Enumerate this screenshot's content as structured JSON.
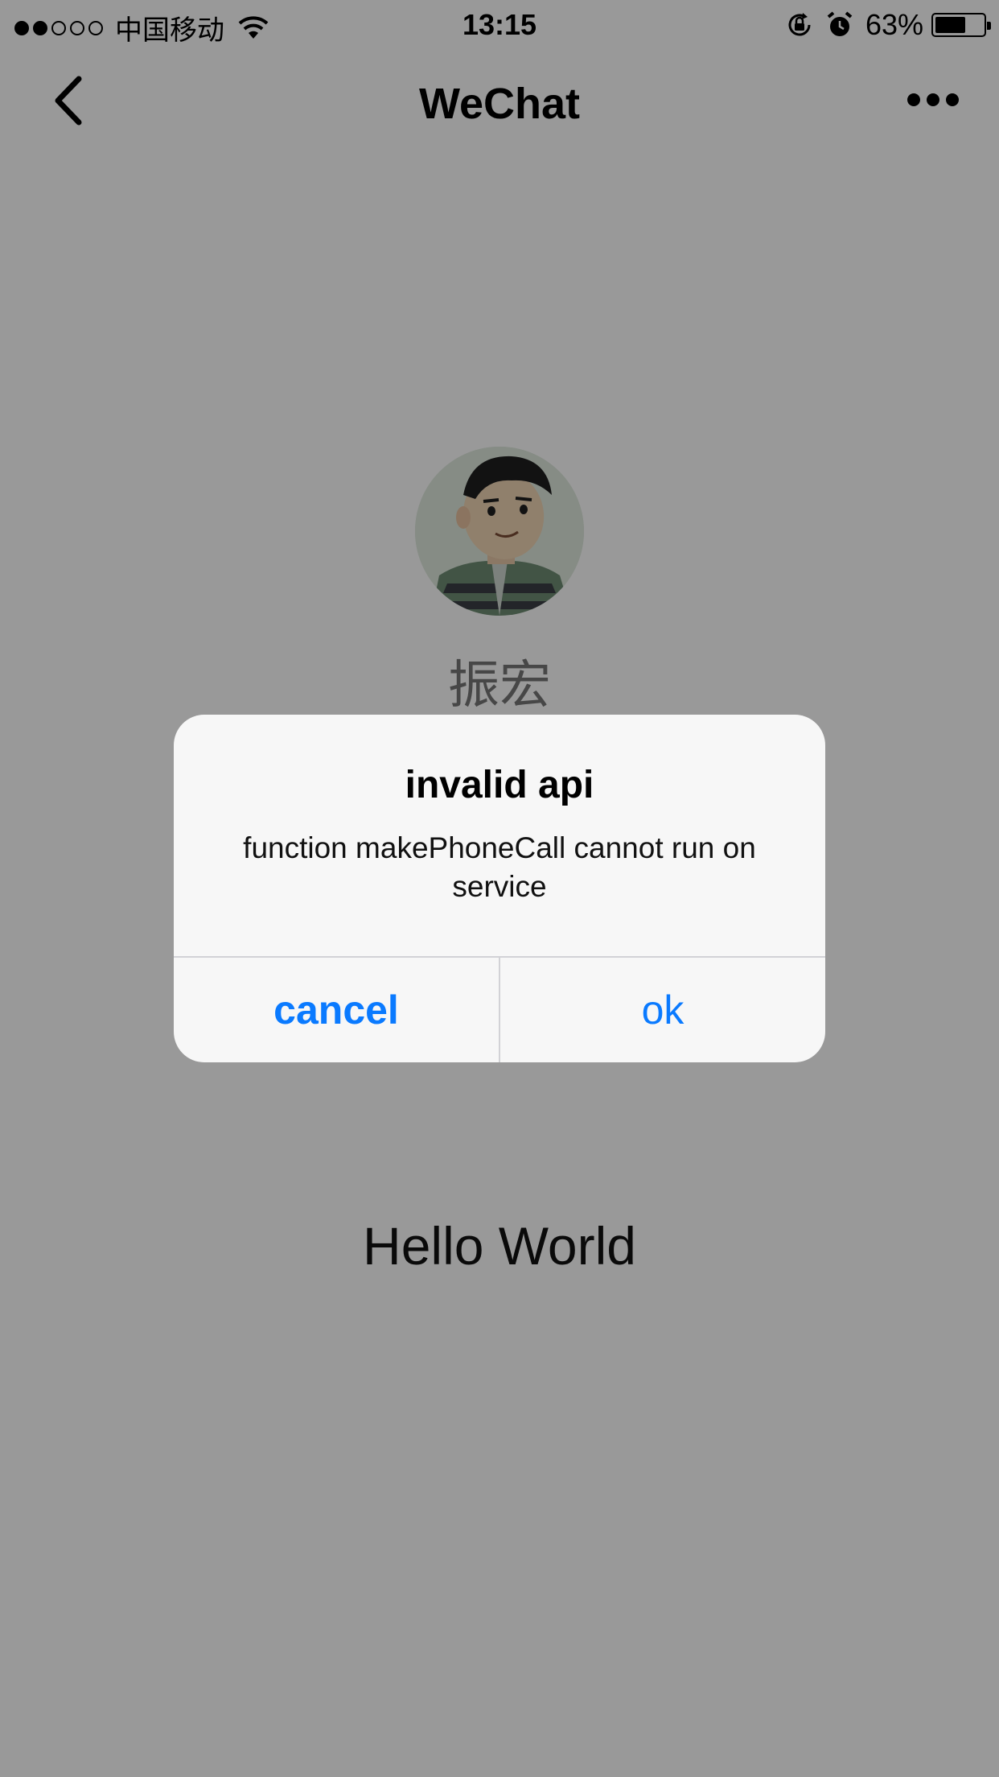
{
  "status_bar": {
    "carrier": "中国移动",
    "time": "13:15",
    "battery_pct": "63%",
    "battery_level": 0.63,
    "signal_strength": 2,
    "signal_max": 5,
    "icons": [
      "wifi-icon",
      "orientation-lock-icon",
      "alarm-icon",
      "battery-icon"
    ]
  },
  "nav": {
    "title": "WeChat",
    "back_icon": "chevron-left-icon",
    "more_icon": "more-dots-icon"
  },
  "profile": {
    "nickname": "振宏"
  },
  "content": {
    "hello": "Hello World"
  },
  "alert": {
    "title": "invalid api",
    "message": "function makePhoneCall cannot run on service",
    "cancel_label": "cancel",
    "ok_label": "ok"
  },
  "colors": {
    "accent": "#0a7aff",
    "overlay": "rgba(0,0,0,0.4)",
    "alert_bg": "#f7f7f7"
  }
}
